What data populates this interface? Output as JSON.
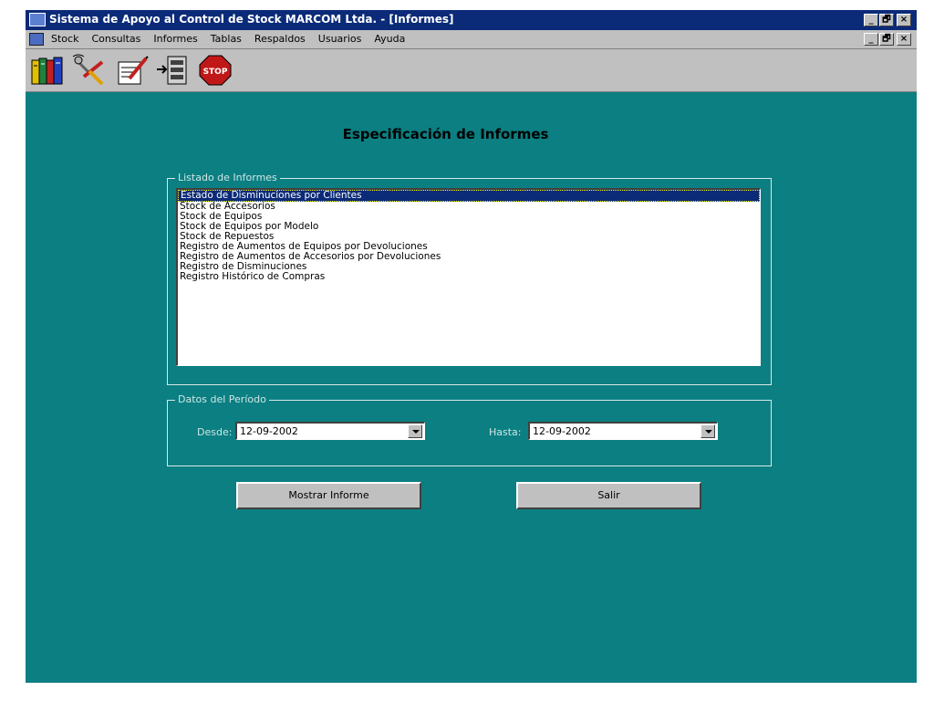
{
  "window": {
    "title": "Sistema de Apoyo al Control de Stock MARCOM Ltda. - [Informes]",
    "controls": {
      "minimize": "_",
      "restore": "🗗",
      "close": "×"
    }
  },
  "menu": {
    "items": [
      "Stock",
      "Consultas",
      "Informes",
      "Tablas",
      "Respaldos",
      "Usuarios",
      "Ayuda"
    ]
  },
  "toolbar": {
    "buttons": [
      {
        "icon": "books-icon"
      },
      {
        "icon": "tools-icon"
      },
      {
        "icon": "edit-document-icon"
      },
      {
        "icon": "database-icon"
      },
      {
        "icon": "stop-icon",
        "label": "STOP"
      }
    ]
  },
  "form": {
    "heading": "Especificación de Informes",
    "reports_group": {
      "legend": "Listado de Informes",
      "selected_index": 0,
      "items": [
        "Estado de Disminuciones por Clientes",
        "Stock de Accesorios",
        "Stock de Equipos",
        "Stock de Equipos por Modelo",
        "Stock de Repuestos",
        "Registro de Aumentos de Equipos por Devoluciones",
        "Registro de Aumentos de Accesorios por Devoluciones",
        "Registro de Disminuciones",
        "Registro Histórico de Compras"
      ]
    },
    "period_group": {
      "legend": "Datos del Período",
      "from_label": "Desde:",
      "from_value": "12-09-2002",
      "to_label": "Hasta:",
      "to_value": "12-09-2002"
    },
    "buttons": {
      "show_report": "Mostrar Informe",
      "exit": "Salir"
    }
  },
  "colors": {
    "titlebar": "#0b2a78",
    "client_background": "#0b7f82",
    "chrome": "#c0c0c0",
    "selection": "#0b2a78"
  }
}
